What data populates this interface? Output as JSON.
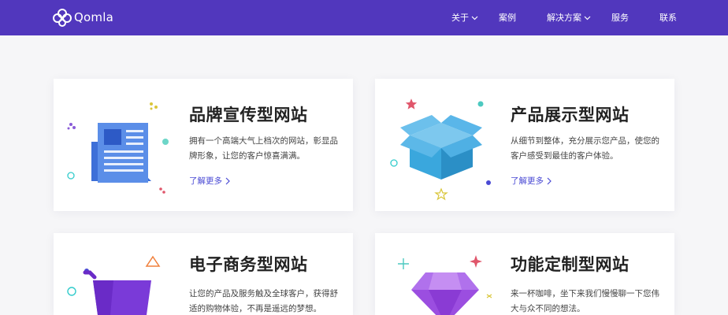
{
  "header": {
    "logo_text": "Qomla",
    "nav": [
      {
        "label": "关于",
        "dropdown": true
      },
      {
        "label": "案例",
        "dropdown": false
      },
      {
        "label": "解决方案",
        "dropdown": true
      },
      {
        "label": "服务",
        "dropdown": false
      },
      {
        "label": "联系",
        "dropdown": false
      }
    ]
  },
  "colors": {
    "nav_bg": "#5137bd",
    "link": "#4a4ad4",
    "icon_blue": "#4a7de0",
    "box_blue": "#3aa7dd",
    "cart_purple": "#6a2bc7",
    "gem_purple": "#9b4ee0"
  },
  "cards": [
    {
      "title": "品牌宣传型网站",
      "desc_line1": "拥有一个高端大气上档次的网站，彰显品",
      "desc_line2": "牌形象，让您的客户惊喜满满。",
      "more": "了解更多",
      "icon": "newspaper-icon"
    },
    {
      "title": "产品展示型网站",
      "desc_line1": "从细节到整体，充分展示您产品，使您的",
      "desc_line2": "客户感受到最佳的客户体验。",
      "more": "了解更多",
      "icon": "box-icon"
    },
    {
      "title": "电子商务型网站",
      "desc_line1": "让您的产品及服务触及全球客户，获得舒",
      "desc_line2": "适的购物体验，不再是遥远的梦想。",
      "icon": "shopping-cart-icon"
    },
    {
      "title": "功能定制型网站",
      "desc_line1": "来一杯咖啡，坐下来我们慢慢聊一下您伟",
      "desc_line2": "大与众不同的想法。",
      "icon": "gem-icon"
    }
  ]
}
